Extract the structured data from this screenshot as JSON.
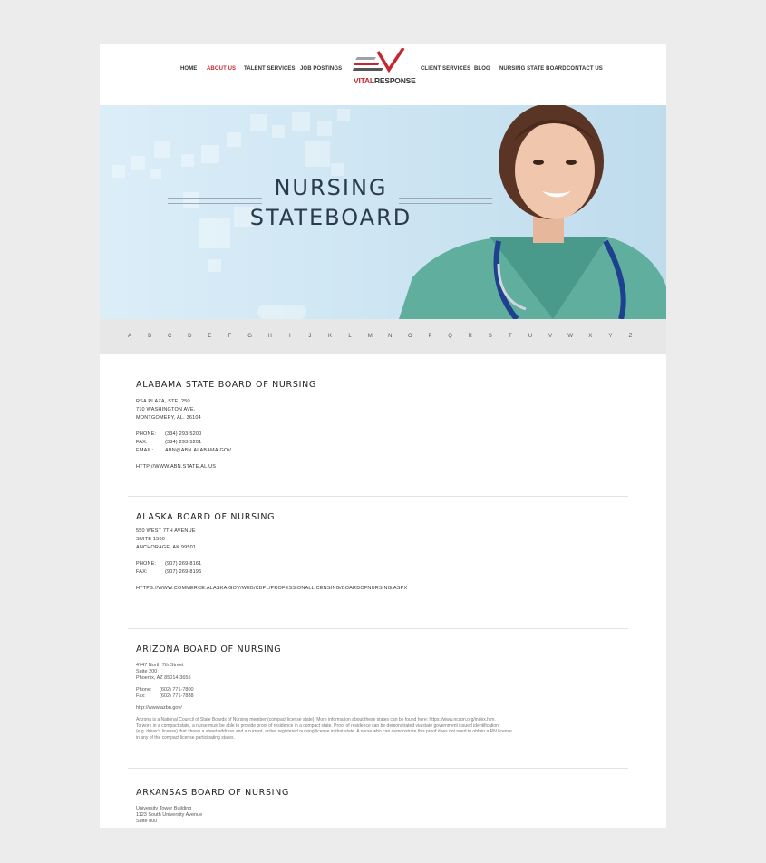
{
  "nav": {
    "left": [
      "HOME",
      "ABOUT US",
      "TALENT SERVICES",
      "JOB POSTINGS"
    ],
    "right": [
      "CLIENT SERVICES",
      "BLOG",
      "NURSING STATE BOARD",
      "CONTACT US"
    ],
    "active": "ABOUT US"
  },
  "logo": {
    "vital": "VITAL",
    "response": "RESPONSE"
  },
  "hero": {
    "line1": "NURSING",
    "line2": "STATEBOARD"
  },
  "alphabet": [
    "A",
    "B",
    "C",
    "D",
    "E",
    "F",
    "G",
    "H",
    "I",
    "J",
    "K",
    "L",
    "M",
    "N",
    "O",
    "P",
    "Q",
    "R",
    "S",
    "T",
    "U",
    "V",
    "W",
    "X",
    "Y",
    "Z"
  ],
  "entries": [
    {
      "title": "ALABAMA STATE BOARD OF NURSING",
      "address": [
        "RSA PLAZA, STE. 250",
        "770 WASHINGTON AVE.",
        "MONTGOMERY, AL. 36104"
      ],
      "phone_label": "PHONE:",
      "phone": "(334) 293-5200",
      "fax_label": "FAX:",
      "fax": "(334) 293-5201",
      "email_label": "EMAIL:",
      "email": "ABN@ABN.ALABAMA.GOV",
      "url": "HTTP://WWW.ABN.STATE.AL.US"
    },
    {
      "title": "ALASKA BOARD OF NURSING",
      "address": [
        "550 WEST 7TH AVENUE",
        "SUITE 1500",
        "ANCHORAGE, AK  99501"
      ],
      "phone_label": "PHONE:",
      "phone": "(907) 269-8161",
      "fax_label": "FAX:",
      "fax": "(907) 269-8196",
      "url": "HTTPS://WWW.COMMERCE.ALASKA.GOV/WEB/CBPL/PROFESSIONALLICENSING/BOARDOFNURSING.ASPX"
    },
    {
      "title": "ARIZONA BOARD OF NURSING",
      "address": [
        "4747 North 7th Street",
        "Suite 200",
        "Phoenix, AZ  85014-3655"
      ],
      "phone_label": "Phone:",
      "phone": "(602) 771-7800",
      "fax_label": "Fax:",
      "fax": "(602) 771-7888",
      "url": "http://www.azbn.gov/",
      "note": [
        "Arizona is a National Council of State Boards of Nursing member (compact license state). More information about these states can be found here: https://www.ncsbn.org/index.htm.",
        "To work in a compact state, a nurse must be able to provide proof of residence in a compact state. Proof of residence can be demonstrated via state government issued identification",
        "(e.g. driver's license) that shows a street address and a current, active registered nursing license in that state. A nurse who can demonstrate this proof does not need to obtain a RN license",
        "in any of the compact license participating states."
      ]
    },
    {
      "title": "ARKANSAS BOARD OF NURSING",
      "address": [
        "University Tower Building",
        "1123 South University Avenue",
        "Suite 800"
      ]
    }
  ]
}
